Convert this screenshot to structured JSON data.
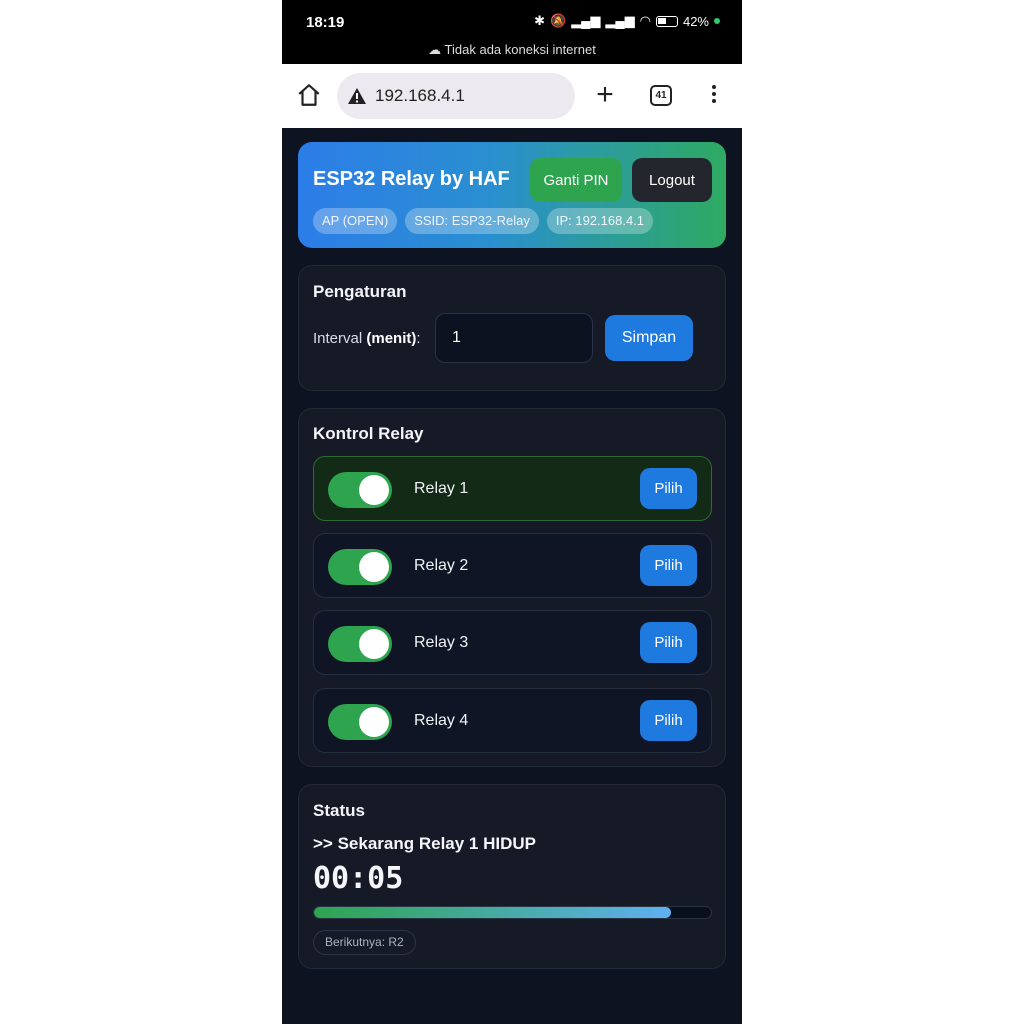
{
  "statusbar": {
    "time": "18:19",
    "battery": "42%",
    "network_message": "Tidak ada koneksi internet"
  },
  "browser": {
    "url": "192.168.4.1",
    "tab_count": "41"
  },
  "header": {
    "title": "ESP32 Relay by HAF",
    "change_pin_label": "Ganti PIN",
    "logout_label": "Logout",
    "chips": [
      "AP (OPEN)",
      "SSID: ESP32-Relay",
      "IP: 192.168.4.1"
    ]
  },
  "settings": {
    "title": "Pengaturan",
    "interval_label": "Interval",
    "interval_unit": "(menit)",
    "interval_value": "1",
    "save_label": "Simpan"
  },
  "relay_control": {
    "title": "Kontrol Relay",
    "relays": [
      {
        "label": "Relay 1",
        "on": true,
        "active": true,
        "button": "Pilih"
      },
      {
        "label": "Relay 2",
        "on": true,
        "active": false,
        "button": "Pilih"
      },
      {
        "label": "Relay 3",
        "on": true,
        "active": false,
        "button": "Pilih"
      },
      {
        "label": "Relay 4",
        "on": true,
        "active": false,
        "button": "Pilih"
      }
    ]
  },
  "status": {
    "title": "Status",
    "message": ">> Sekarang Relay 1 HIDUP",
    "timer": "00:05",
    "progress": 0.9,
    "next": "Berikutnya: R2"
  },
  "colors": {
    "accent_blue": "#1f7ae0",
    "accent_green": "#2ea44f",
    "background": "#0d1321"
  }
}
